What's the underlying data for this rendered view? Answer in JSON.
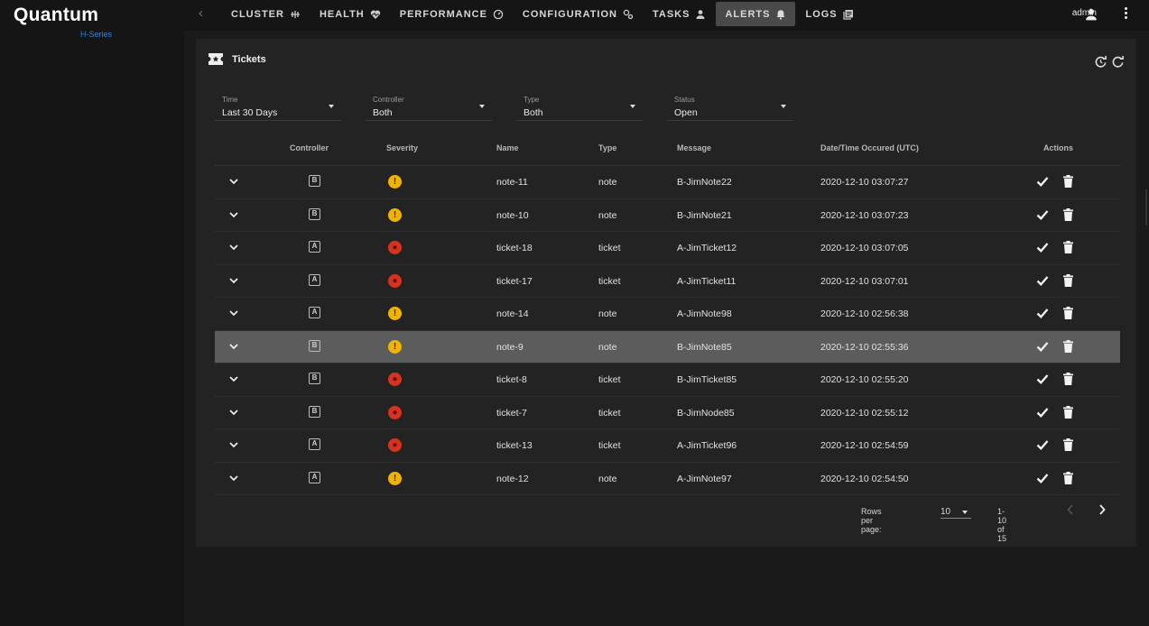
{
  "brand": {
    "name": "Quantum",
    "sub": "H-Series"
  },
  "nav": {
    "items": [
      {
        "label": "CLUSTER",
        "icon": "cluster-icon"
      },
      {
        "label": "HEALTH",
        "icon": "heart-pulse-icon"
      },
      {
        "label": "PERFORMANCE",
        "icon": "speedometer-icon"
      },
      {
        "label": "CONFIGURATION",
        "icon": "gears-icon"
      },
      {
        "label": "TASKS",
        "icon": "person-icon"
      },
      {
        "label": "ALERTS",
        "icon": "bell-icon"
      },
      {
        "label": "LOGS",
        "icon": "logs-icon"
      }
    ],
    "active": "ALERTS"
  },
  "user": {
    "name": "admin"
  },
  "panel": {
    "title": "Tickets"
  },
  "filters": [
    {
      "label": "Time",
      "value": "Last 30 Days"
    },
    {
      "label": "Controller",
      "value": "Both"
    },
    {
      "label": "Type",
      "value": "Both"
    },
    {
      "label": "Status",
      "value": "Open"
    }
  ],
  "table": {
    "headers": {
      "controller": "Controller",
      "severity": "Severity",
      "name": "Name",
      "type": "Type",
      "message": "Message",
      "datetime": "Date/Time Occured (UTC)",
      "actions": "Actions"
    },
    "rows": [
      {
        "controller": "B",
        "severity": "warning",
        "name": "note-11",
        "type": "note",
        "message": "B-JimNote22",
        "datetime": "2020-12-10 03:07:27"
      },
      {
        "controller": "B",
        "severity": "warning",
        "name": "note-10",
        "type": "note",
        "message": "B-JimNote21",
        "datetime": "2020-12-10 03:07:23"
      },
      {
        "controller": "A",
        "severity": "critical",
        "name": "ticket-18",
        "type": "ticket",
        "message": "A-JimTicket12",
        "datetime": "2020-12-10 03:07:05"
      },
      {
        "controller": "A",
        "severity": "critical",
        "name": "ticket-17",
        "type": "ticket",
        "message": "A-JimTicket11",
        "datetime": "2020-12-10 03:07:01"
      },
      {
        "controller": "A",
        "severity": "warning",
        "name": "note-14",
        "type": "note",
        "message": "A-JimNote98",
        "datetime": "2020-12-10 02:56:38"
      },
      {
        "controller": "B",
        "severity": "warning",
        "name": "note-9",
        "type": "note",
        "message": "B-JimNote85",
        "datetime": "2020-12-10 02:55:36",
        "highlighted": true
      },
      {
        "controller": "B",
        "severity": "critical",
        "name": "ticket-8",
        "type": "ticket",
        "message": "B-JimTicket85",
        "datetime": "2020-12-10 02:55:20"
      },
      {
        "controller": "B",
        "severity": "critical",
        "name": "ticket-7",
        "type": "ticket",
        "message": "B-JimNode85",
        "datetime": "2020-12-10 02:55:12"
      },
      {
        "controller": "A",
        "severity": "critical",
        "name": "ticket-13",
        "type": "ticket",
        "message": "A-JimTicket96",
        "datetime": "2020-12-10 02:54:59"
      },
      {
        "controller": "A",
        "severity": "warning",
        "name": "note-12",
        "type": "note",
        "message": "A-JimNote97",
        "datetime": "2020-12-10 02:54:50"
      }
    ]
  },
  "pagination": {
    "rows_per_page_label": "Rows per page:",
    "rows_per_page": "10",
    "range": "1-10 of 15"
  },
  "colors": {
    "warning": "#f0b400",
    "critical": "#d6331f",
    "highlight_row": "#5c5c5c"
  }
}
